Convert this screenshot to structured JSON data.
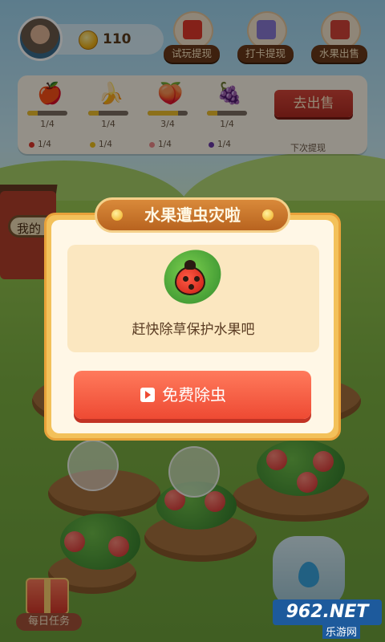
{
  "player": {
    "coins": "110"
  },
  "top_buttons": [
    {
      "label": "试玩提现",
      "icon": "red-envelope-icon"
    },
    {
      "label": "打卡提现",
      "icon": "calendar-check-icon"
    },
    {
      "label": "水果出售",
      "icon": "shop-icon"
    }
  ],
  "fruits": [
    {
      "name": "apple",
      "glyph": "🍎",
      "progress": "1/4",
      "badge": "1/4",
      "fill": 0.25,
      "color": "#e0362a"
    },
    {
      "name": "banana",
      "glyph": "🍌",
      "progress": "1/4",
      "badge": "1/4",
      "fill": 0.25,
      "color": "#f1c21b"
    },
    {
      "name": "peach",
      "glyph": "🍑",
      "progress": "3/4",
      "badge": "1/4",
      "fill": 0.75,
      "color": "#f08a8a"
    },
    {
      "name": "grape",
      "glyph": "🍇",
      "progress": "1/4",
      "badge": "1/4",
      "fill": 0.25,
      "color": "#6b3aa8"
    }
  ],
  "sell": {
    "label": "去出售",
    "next": "下次提现"
  },
  "barn": {
    "label": "我的"
  },
  "modal": {
    "title": "水果遭虫灾啦",
    "description": "赶快除草保护水果吧",
    "cta": "免费除虫"
  },
  "daily": {
    "label": "每日任务"
  },
  "watermark": {
    "logo": "962.NET",
    "sub": "乐游网"
  }
}
